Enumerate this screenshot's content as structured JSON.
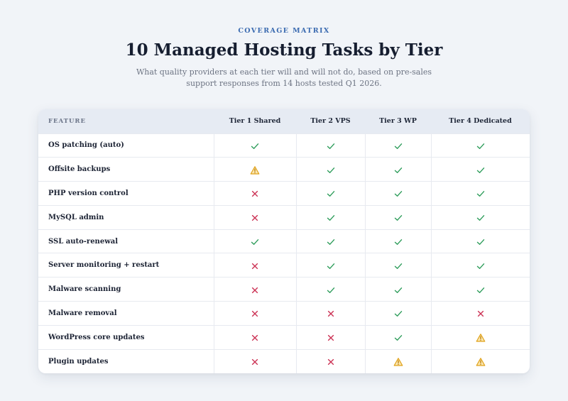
{
  "header": {
    "eyebrow": "COVERAGE MATRIX",
    "title": "10 Managed Hosting Tasks by Tier",
    "subtitle": "What quality providers at each tier will and will not do, based on pre-sales support responses from 14 hosts tested Q1 2026."
  },
  "table": {
    "columns": [
      "FEATURE",
      "Tier 1 Shared",
      "Tier 2 VPS",
      "Tier 3 WP",
      "Tier 4 Dedicated"
    ],
    "rows": [
      {
        "feature": "OS patching (auto)",
        "values": [
          "yes",
          "yes",
          "yes",
          "yes"
        ]
      },
      {
        "feature": "Offsite backups",
        "values": [
          "partial",
          "yes",
          "yes",
          "yes"
        ]
      },
      {
        "feature": "PHP version control",
        "values": [
          "no",
          "yes",
          "yes",
          "yes"
        ]
      },
      {
        "feature": "MySQL admin",
        "values": [
          "no",
          "yes",
          "yes",
          "yes"
        ]
      },
      {
        "feature": "SSL auto-renewal",
        "values": [
          "yes",
          "yes",
          "yes",
          "yes"
        ]
      },
      {
        "feature": "Server monitoring + restart",
        "values": [
          "no",
          "yes",
          "yes",
          "yes"
        ]
      },
      {
        "feature": "Malware scanning",
        "values": [
          "no",
          "yes",
          "yes",
          "yes"
        ]
      },
      {
        "feature": "Malware removal",
        "values": [
          "no",
          "no",
          "yes",
          "no"
        ]
      },
      {
        "feature": "WordPress core updates",
        "values": [
          "no",
          "no",
          "yes",
          "partial"
        ]
      },
      {
        "feature": "Plugin updates",
        "values": [
          "no",
          "no",
          "partial",
          "partial"
        ]
      }
    ]
  },
  "icons": {
    "yes": "check-icon",
    "no": "cross-icon",
    "partial": "warning-icon"
  },
  "colors": {
    "yes": "#2e9d5b",
    "no": "#cc3355",
    "partial": "#e0a21a",
    "accent": "#3a6ab0"
  }
}
